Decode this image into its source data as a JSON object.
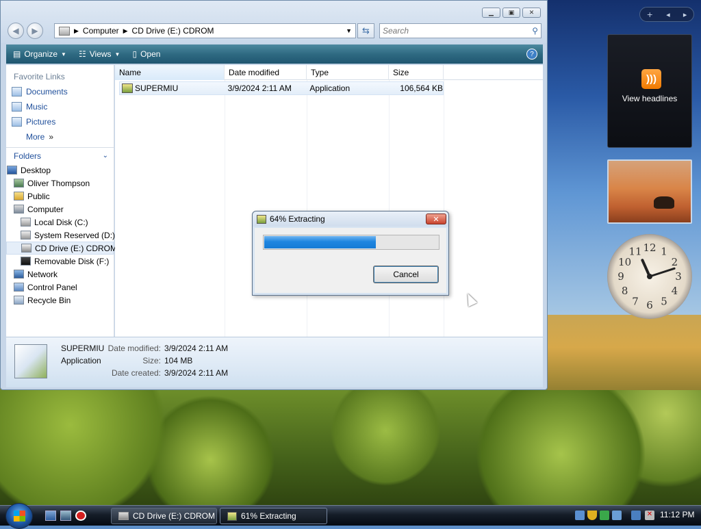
{
  "explorer": {
    "address_parts": [
      "Computer",
      "CD Drive (E:) CDROM"
    ],
    "search_placeholder": "Search",
    "toolbar": {
      "organize": "Organize",
      "views": "Views",
      "open": "Open"
    },
    "favorite_links_heading": "Favorite Links",
    "favorites": [
      {
        "label": "Documents",
        "icon": "documents-icon"
      },
      {
        "label": "Music",
        "icon": "music-icon"
      },
      {
        "label": "Pictures",
        "icon": "pictures-icon"
      },
      {
        "label": "More",
        "icon": "double-chevron-icon"
      }
    ],
    "folders_heading": "Folders",
    "tree": [
      {
        "label": "Desktop",
        "indent": 0,
        "icon": "desktop-icon"
      },
      {
        "label": "Oliver Thompson",
        "indent": 1,
        "icon": "user-folder-icon"
      },
      {
        "label": "Public",
        "indent": 1,
        "icon": "folder-icon"
      },
      {
        "label": "Computer",
        "indent": 1,
        "icon": "computer-icon"
      },
      {
        "label": "Local Disk (C:)",
        "indent": 2,
        "icon": "hard-disk-icon"
      },
      {
        "label": "System Reserved (D:)",
        "indent": 2,
        "icon": "hard-disk-icon"
      },
      {
        "label": "CD Drive (E:) CDROM",
        "indent": 2,
        "icon": "cd-drive-icon",
        "selected": true
      },
      {
        "label": "Removable Disk (F:)",
        "indent": 2,
        "icon": "removable-disk-icon"
      },
      {
        "label": "Network",
        "indent": 1,
        "icon": "network-icon"
      },
      {
        "label": "Control Panel",
        "indent": 1,
        "icon": "control-panel-icon"
      },
      {
        "label": "Recycle Bin",
        "indent": 1,
        "icon": "recycle-bin-icon"
      }
    ],
    "columns": [
      "Name",
      "Date modified",
      "Type",
      "Size"
    ],
    "files": [
      {
        "name": "SUPERMIU",
        "date": "3/9/2024 2:11 AM",
        "type": "Application",
        "size": "106,564 KB"
      }
    ],
    "details": {
      "name": "SUPERMIU",
      "kind": "Application",
      "date_modified_label": "Date modified:",
      "date_modified": "3/9/2024 2:11 AM",
      "size_label": "Size:",
      "size": "104 MB",
      "date_created_label": "Date created:",
      "date_created": "3/9/2024 2:11 AM"
    }
  },
  "dialog": {
    "title": "64% Extracting",
    "progress": 0.64,
    "cancel": "Cancel"
  },
  "gadgets": {
    "rss_label": "View headlines",
    "clock": {
      "hour": 11,
      "minute": 12
    }
  },
  "taskbar": {
    "tasks": [
      "CD Drive (E:) CDROM",
      "61% Extracting"
    ],
    "time": "11:12 PM"
  },
  "colors": {
    "accent": "#1f86e0",
    "toolbar": "#2f6a82"
  }
}
